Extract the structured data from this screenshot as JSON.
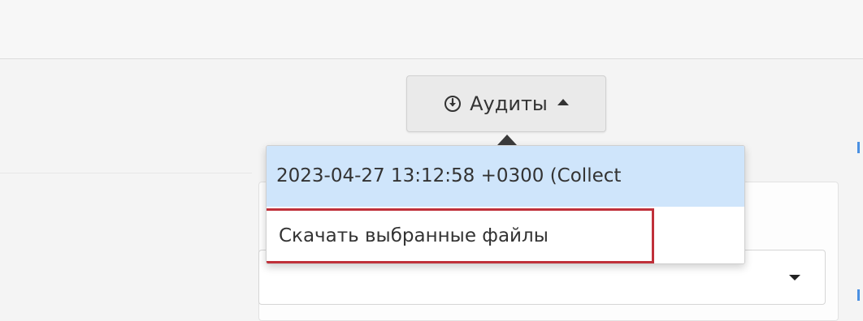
{
  "audits_button": {
    "label": "Аудиты",
    "icon": "download-circle-icon",
    "caret_icon": "caret-up-icon"
  },
  "dropdown": {
    "items": [
      {
        "label": "2023-04-27 13:12:58 +0300 (Collect",
        "state": "highlighted"
      },
      {
        "label": "Скачать выбранные файлы",
        "state": "outlined"
      }
    ],
    "highlight_color": "#cfe5fb",
    "outline_color": "#c0303a"
  },
  "background": {
    "select_caret_icon": "caret-down-icon"
  }
}
